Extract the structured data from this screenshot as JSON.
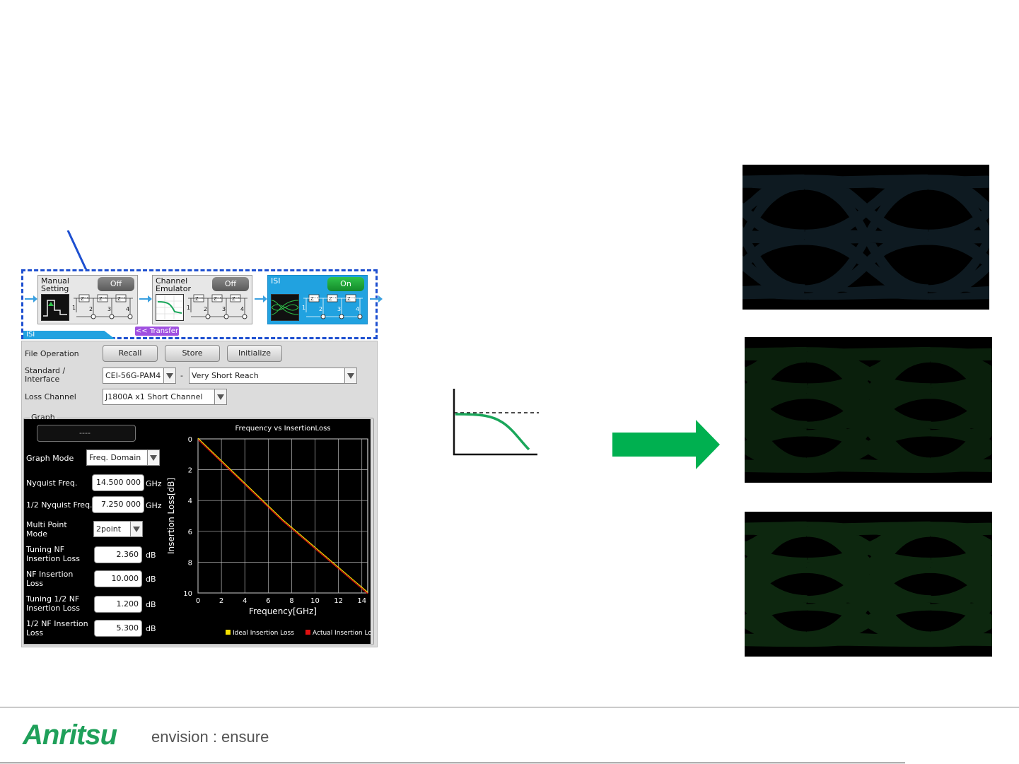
{
  "blocks": [
    {
      "title": "Manual Setting",
      "state": "Off"
    },
    {
      "title": "Channel Emulator",
      "state": "Off"
    },
    {
      "title": "ISI",
      "state": "On"
    }
  ],
  "taps": [
    "Z",
    "Z",
    "Z",
    "1",
    "2",
    "3",
    "4"
  ],
  "transfer_label": "<< Transfer",
  "isi_tab_label": "ISI",
  "panel": {
    "file_operation_label": "File Operation",
    "recall": "Recall",
    "store": "Store",
    "initialize": "Initialize",
    "standard_label": "Standard / Interface",
    "standard_value": "CEI-56G-PAM4",
    "dash": "-",
    "reach_value": "Very Short Reach",
    "loss_channel_label": "Loss Channel",
    "loss_channel_value": "J1800A x1 Short Channel",
    "graph_group_label": "Graph"
  },
  "graph_controls": {
    "display": "----",
    "graph_mode_label": "Graph Mode",
    "graph_mode_value": "Freq. Domain",
    "nyquist_label": "Nyquist Freq.",
    "nyquist_value": "14.500 000",
    "nyquist_unit": "GHz",
    "half_nyquist_label": "1/2 Nyquist Freq.",
    "half_nyquist_value": "7.250 000",
    "half_nyquist_unit": "GHz",
    "multipoint_label_1": "Multi Point",
    "multipoint_label_2": "Mode",
    "multipoint_value": "2point",
    "tuning_nf_label_1": "Tuning NF",
    "tuning_nf_label_2": "Insertion Loss",
    "tuning_nf_value": "2.360",
    "nf_il_label_1": "NF Insertion",
    "nf_il_label_2": "Loss",
    "nf_il_value": "10.000",
    "tuning_half_label_1": "Tuning 1/2 NF",
    "tuning_half_label_2": "Insertion Loss",
    "tuning_half_value": "1.200",
    "half_nf_label_1": "1/2 NF Insertion",
    "half_nf_label_2": "Loss",
    "half_nf_value": "5.300",
    "db_unit": "dB"
  },
  "chart_data": {
    "type": "line",
    "title": "Frequency vs InsertionLoss",
    "xlabel": "Frequency[GHz]",
    "ylabel": "Insertion Loss[dB]",
    "xlim": [
      0,
      14.5
    ],
    "ylim": [
      0,
      10
    ],
    "y_inverted": true,
    "xticks": [
      "0",
      "2",
      "4",
      "6",
      "8",
      "10",
      "12",
      "14"
    ],
    "yticks": [
      "0",
      "2",
      "4",
      "6",
      "8",
      "10"
    ],
    "grid": true,
    "legend_placement": "bottom",
    "series": [
      {
        "name": "Ideal Insertion Loss",
        "color": "#f5e000",
        "x": [
          0,
          7.25,
          14.5
        ],
        "y": [
          0,
          5.3,
          10
        ]
      },
      {
        "name": "Actual Insertion Loss",
        "color": "#e01010",
        "x": [
          0,
          7.25,
          14.5
        ],
        "y": [
          0,
          5.3,
          10
        ]
      }
    ]
  },
  "colors": {
    "accent_blue": "#21a2e0",
    "on_green": "#1fa53a",
    "arrow_green": "#00b050",
    "brand_green": "#1fa05a"
  },
  "footer": {
    "logo": "Anritsu",
    "tagline": "envision : ensure"
  }
}
